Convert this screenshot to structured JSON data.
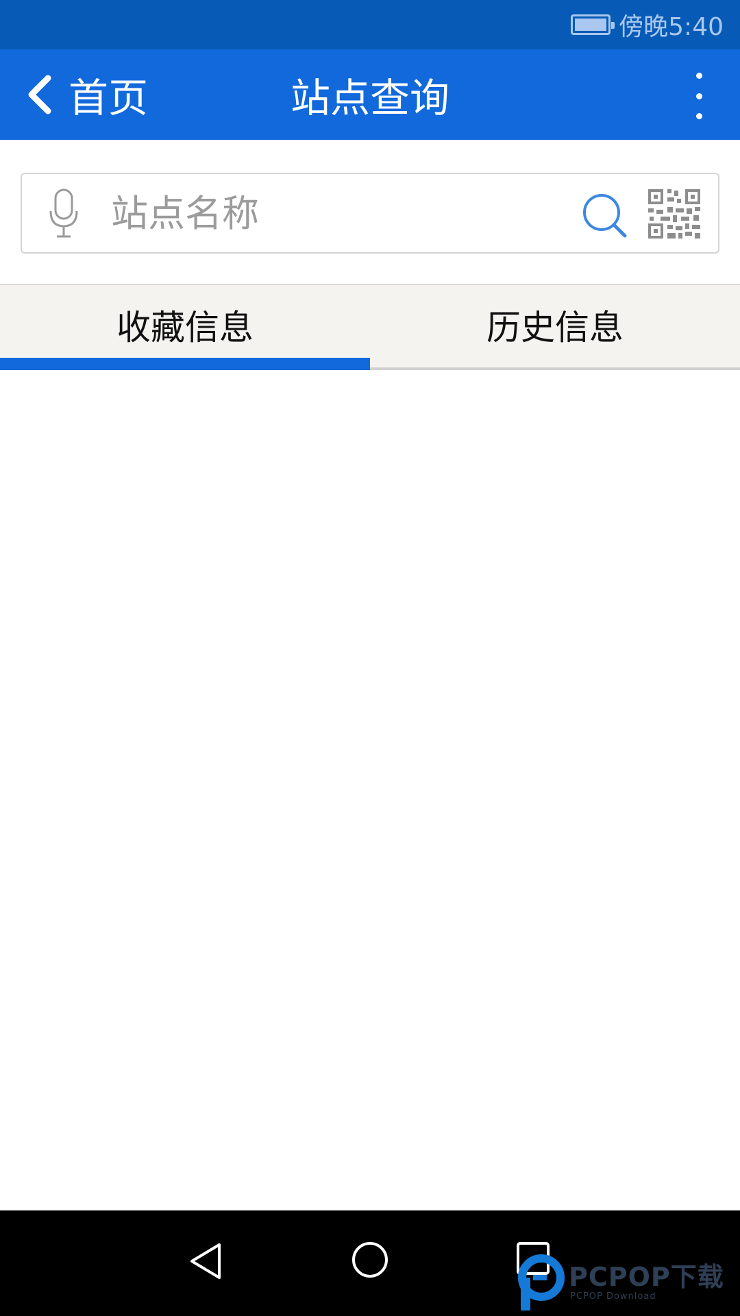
{
  "status_bar": {
    "time": "傍晚5:40",
    "battery_icon": "battery-full-icon"
  },
  "action_bar": {
    "back_icon": "chevron-left-icon",
    "back_label": "首页",
    "title": "站点查询",
    "menu_icon": "more-vertical-icon"
  },
  "search": {
    "mic_icon": "microphone-icon",
    "placeholder": "站点名称",
    "value": "",
    "search_icon": "search-icon",
    "qr_icon": "qr-code-icon"
  },
  "tabs": [
    {
      "label": "收藏信息",
      "selected": true
    },
    {
      "label": "历史信息",
      "selected": false
    }
  ],
  "nav_bar": {
    "back_icon": "nav-back-icon",
    "home_icon": "nav-home-icon",
    "recent_icon": "nav-recent-icon"
  },
  "watermark": {
    "brand": "PCPOP下载",
    "sub": "PCPOP Download"
  },
  "colors": {
    "status_bar": "#075bb6",
    "action_bar": "#1169dc",
    "tab_indicator": "#1169dc",
    "tab_bar_bg": "#f4f3f0",
    "search_icon": "#3d87e0"
  }
}
